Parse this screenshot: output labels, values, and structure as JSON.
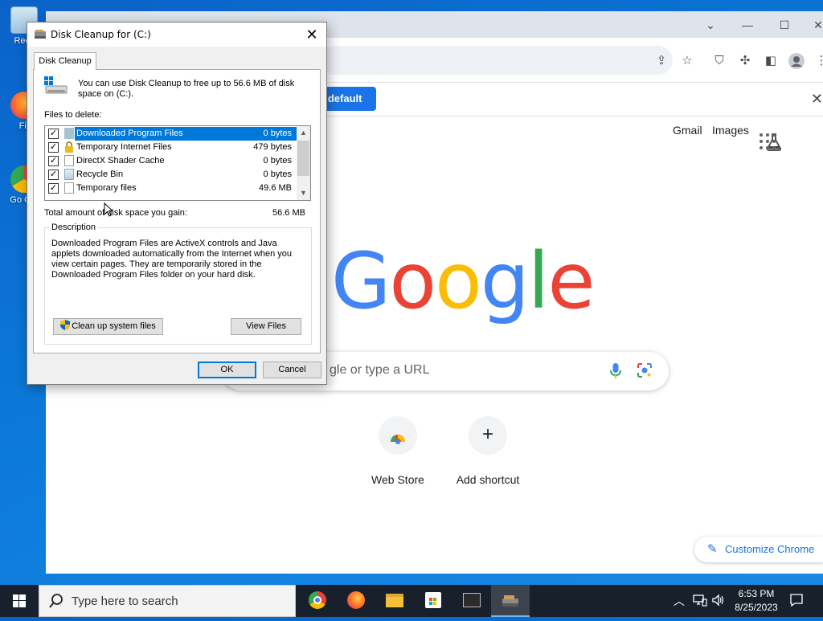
{
  "desktop": {
    "icons": [
      {
        "label": "Recy",
        "icon": "recycle-bin-icon"
      },
      {
        "label": "Fir",
        "icon": "firefox-icon"
      },
      {
        "label": "Go Chr",
        "icon": "chrome-icon"
      }
    ]
  },
  "chrome": {
    "infobar_button": "s default",
    "top_links": {
      "gmail": "Gmail",
      "images": "Images"
    },
    "logo_letters": [
      {
        "ch": "G",
        "color": "#4285f4"
      },
      {
        "ch": "o",
        "color": "#ea4335"
      },
      {
        "ch": "o",
        "color": "#fbbc05"
      },
      {
        "ch": "g",
        "color": "#4285f4"
      },
      {
        "ch": "l",
        "color": "#34a853"
      },
      {
        "ch": "e",
        "color": "#ea4335"
      }
    ],
    "search_placeholder": "gle or type a URL",
    "shortcuts": [
      {
        "label": "Web Store",
        "icon": "web-store-icon"
      },
      {
        "label": "Add shortcut",
        "icon": "plus-icon"
      }
    ],
    "customize_label": "Customize Chrome"
  },
  "dialog": {
    "title": "Disk Cleanup for  (C:)",
    "tab": "Disk Cleanup",
    "intro": "You can use Disk Cleanup to free up to 56.6 MB of disk space on  (C:).",
    "files_label": "Files to delete:",
    "files": [
      {
        "name": "Downloaded Program Files",
        "size": "0 bytes",
        "checked": true,
        "selected": true,
        "icon": "folder-icon"
      },
      {
        "name": "Temporary Internet Files",
        "size": "479 bytes",
        "checked": true,
        "selected": false,
        "icon": "lock-icon"
      },
      {
        "name": "DirectX Shader Cache",
        "size": "0 bytes",
        "checked": true,
        "selected": false,
        "icon": "document-icon"
      },
      {
        "name": "Recycle Bin",
        "size": "0 bytes",
        "checked": true,
        "selected": false,
        "icon": "recycle-bin-icon"
      },
      {
        "name": "Temporary files",
        "size": "49.6 MB",
        "checked": true,
        "selected": false,
        "icon": "document-icon"
      }
    ],
    "total_label": "Total amount of disk space you gain:",
    "total_value": "56.6 MB",
    "description_label": "Description",
    "description": "Downloaded Program Files are ActiveX controls and Java applets downloaded automatically from the Internet when you view certain pages. They are temporarily stored in the Downloaded Program Files folder on your hard disk.",
    "cleanup_system_button": "Clean up system files",
    "view_files_button": "View Files",
    "ok_button": "OK",
    "cancel_button": "Cancel"
  },
  "taskbar": {
    "search_placeholder": "Type here to search",
    "time": "6:53 PM",
    "date": "8/25/2023"
  }
}
